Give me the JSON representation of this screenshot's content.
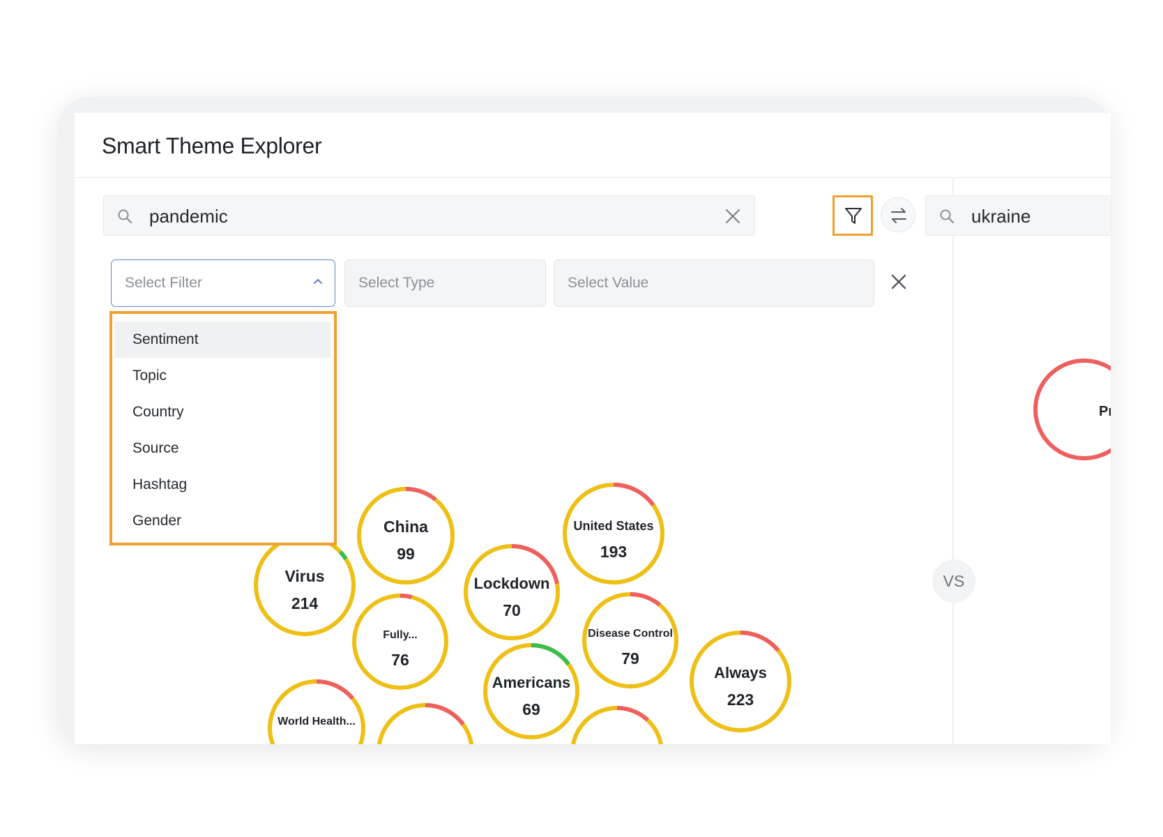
{
  "header": {
    "title": "Smart Theme Explorer"
  },
  "left_search": {
    "query": "pandemic"
  },
  "right_search": {
    "query": "ukraine"
  },
  "filters": {
    "filter_placeholder": "Select Filter",
    "type_placeholder": "Select Type",
    "value_placeholder": "Select Value",
    "dropdown_options": [
      "Sentiment",
      "Topic",
      "Country",
      "Source",
      "Hashtag",
      "Gender"
    ],
    "highlighted_option": "Sentiment"
  },
  "vs_label": "VS",
  "colors": {
    "highlight": "#f0a030",
    "neutral": "#eebf14",
    "negative": "#ee6060",
    "positive": "#3bbe4f",
    "accent_blue": "#5d86c7"
  },
  "themes_left": [
    {
      "name": "Virus",
      "count": "214"
    },
    {
      "name": "China",
      "count": "99"
    },
    {
      "name": "Lockdown",
      "count": "70"
    },
    {
      "name": "United States",
      "count": "193"
    },
    {
      "name": "Fully...",
      "count": "76"
    },
    {
      "name": "Disease Control",
      "count": "79"
    },
    {
      "name": "Americans",
      "count": "69"
    },
    {
      "name": "Always",
      "count": "223"
    },
    {
      "name": "World Health...",
      "count": ""
    },
    {
      "name": "",
      "count": ""
    },
    {
      "name": "",
      "count": ""
    }
  ],
  "themes_right": [
    {
      "name": "Pr",
      "count": ""
    }
  ]
}
